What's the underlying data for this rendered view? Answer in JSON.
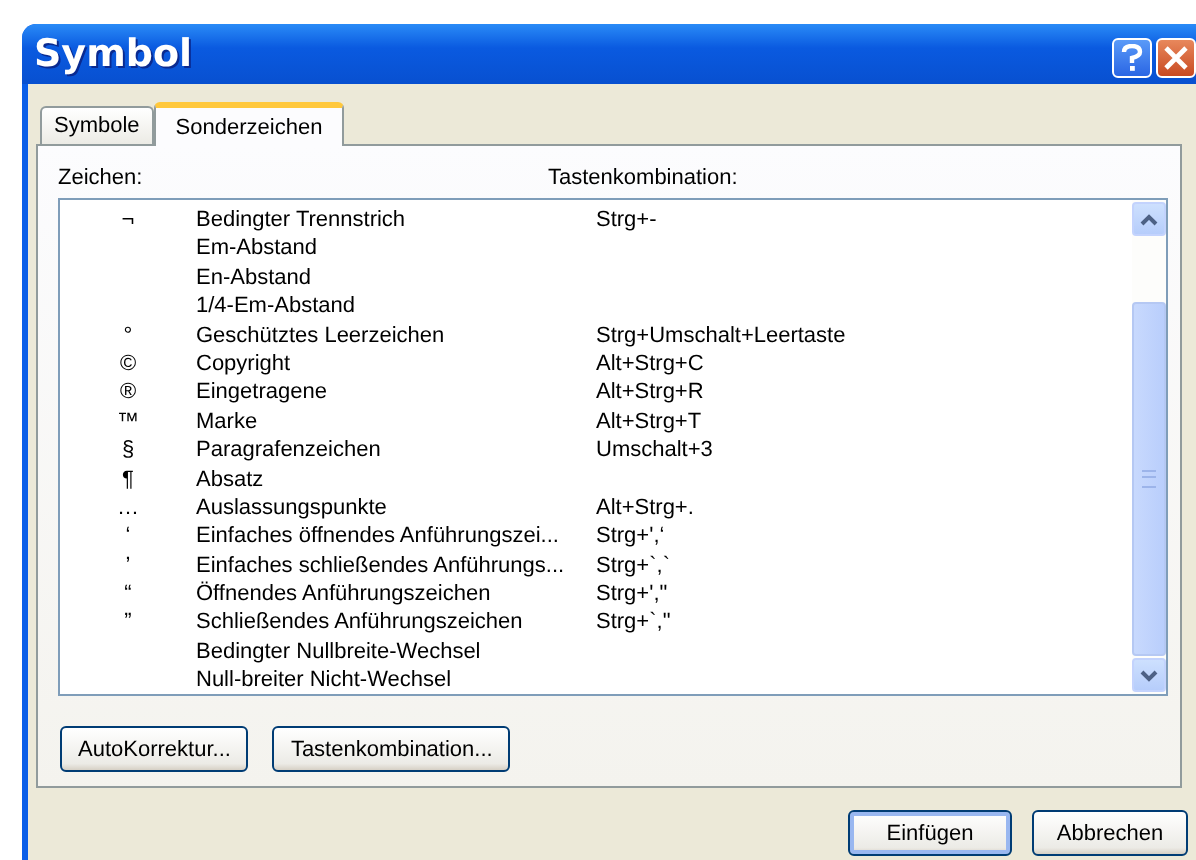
{
  "window": {
    "title": "Symbol"
  },
  "tabs": [
    {
      "label": "Symbole",
      "selected": false
    },
    {
      "label": "Sonderzeichen",
      "selected": true
    }
  ],
  "list": {
    "columns": [
      "Zeichen:",
      "Tastenkombination:"
    ],
    "rows": [
      {
        "symbol": "¬",
        "name": "Bedingter Trennstrich",
        "shortcut": "Strg+-"
      },
      {
        "name": "Em-Abstand"
      },
      {
        "name": "En-Abstand"
      },
      {
        "name": "1/4-Em-Abstand"
      },
      {
        "symbol": "°",
        "name": "Geschütztes Leerzeichen",
        "shortcut": "Strg+Umschalt+Leertaste"
      },
      {
        "symbol": "©",
        "name": "Copyright",
        "shortcut": "Alt+Strg+C"
      },
      {
        "symbol": "®",
        "name": "Eingetragene",
        "shortcut": "Alt+Strg+R"
      },
      {
        "symbol": "™",
        "name": "Marke",
        "shortcut": "Alt+Strg+T"
      },
      {
        "symbol": "§",
        "name": "Paragrafenzeichen",
        "shortcut": "Umschalt+3"
      },
      {
        "symbol": "¶",
        "name": "Absatz"
      },
      {
        "symbol": "…",
        "name": "Auslassungspunkte",
        "shortcut": "Alt+Strg+."
      },
      {
        "symbol": "‘",
        "name": "Einfaches öffnendes Anführungszei...",
        "shortcut": "Strg+',‘"
      },
      {
        "symbol": "’",
        "name": "Einfaches schließendes Anführungs...",
        "shortcut": "Strg+`,`"
      },
      {
        "symbol": "“",
        "name": "Öffnendes Anführungszeichen",
        "shortcut": "Strg+',\""
      },
      {
        "symbol": "”",
        "name": "Schließendes Anführungszeichen",
        "shortcut": "Strg+`,\""
      },
      {
        "name": "Bedingter Nullbreite-Wechsel"
      },
      {
        "name": "Null-breiter Nicht-Wechsel"
      }
    ]
  },
  "panel_buttons": [
    "AutoKorrektur...",
    "Tastenkombination..."
  ],
  "dialog_buttons": [
    {
      "label": "Einfügen",
      "default": true
    },
    {
      "label": "Abbrechen",
      "default": false
    }
  ]
}
